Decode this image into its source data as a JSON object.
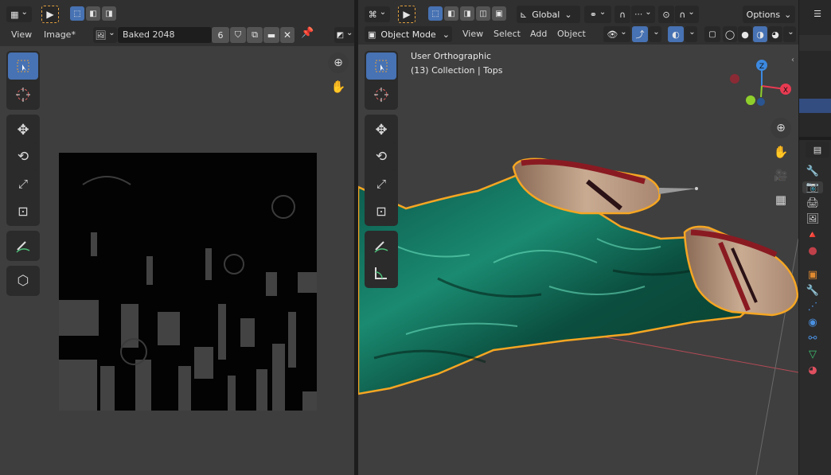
{
  "uv_editor": {
    "menu": {
      "view": "View",
      "image": "Image*"
    },
    "image_name": "Baked 2048",
    "user_count": "6",
    "editor_type_icon": "image-editor-icon",
    "tools": [
      "select-box",
      "cursor",
      "move",
      "rotate",
      "scale",
      "transform",
      "annotate",
      "grab-uv"
    ]
  },
  "viewport": {
    "menu": {
      "view": "View",
      "select": "Select",
      "add": "Add",
      "object": "Object"
    },
    "mode": "Object Mode",
    "orientation": "Global",
    "options_label": "Options",
    "overlay_line1": "User Orthographic",
    "overlay_line2": "(13) Collection | Tops",
    "gizmo_axes": {
      "x": "X",
      "y": "Y",
      "z": "Z"
    },
    "colors": {
      "x_axis": "#e83a51",
      "y_axis": "#8fcf2c",
      "z_axis": "#3c89e0",
      "selection_outline": "#f5a623",
      "fabric": "#1a8a70",
      "accent": "#4772b3"
    }
  },
  "properties": {
    "tabs": [
      "tool",
      "render",
      "output",
      "view-layer",
      "scene",
      "world",
      "object",
      "modifiers",
      "particles",
      "physics",
      "constraints",
      "data",
      "material"
    ]
  }
}
